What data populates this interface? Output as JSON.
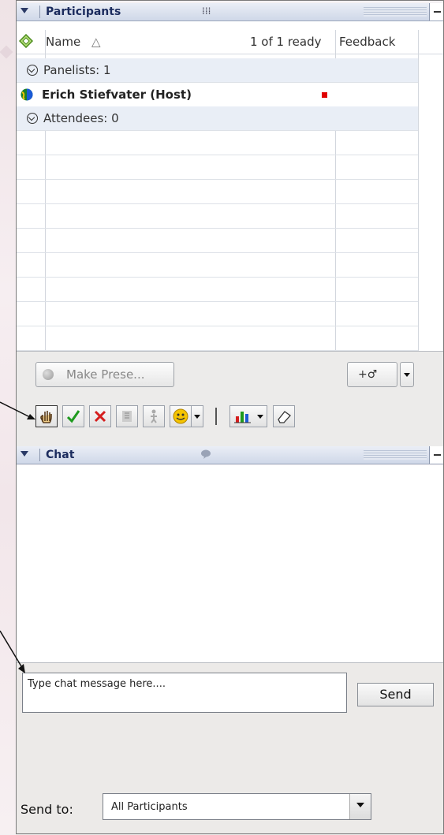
{
  "participants_panel": {
    "title": "Participants",
    "columns": {
      "name": "Name",
      "sort_indicator": "△",
      "ready": "1 of 1 ready",
      "feedback": "Feedback"
    },
    "panelists_label": "Panelists: 1",
    "host_name": "Erich Stiefvater (Host)",
    "attendees_label": "Attendees: 0",
    "make_presenter_label": "Make Prese...",
    "invite_label": "+♂",
    "status_color": "#e00000"
  },
  "feedback_toolbar": {
    "icons": [
      "raise-hand-icon",
      "checkmark-icon",
      "x-mark-icon",
      "go-faster-icon",
      "go-slower-icon",
      "emoticons-icon",
      "poll-chart-icon",
      "eraser-icon"
    ]
  },
  "chat_panel": {
    "title": "Chat",
    "input_placeholder": "Type chat message here....",
    "send_label": "Send",
    "send_to_label": "Send to:",
    "send_to_value": "All Participants"
  }
}
